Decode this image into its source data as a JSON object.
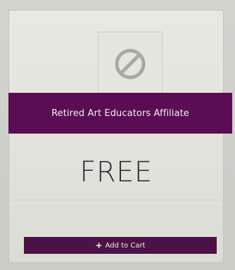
{
  "product": {
    "title": "Retired Art Educators Affiliate",
    "price": "FREE",
    "image_icon": "no-image-icon"
  },
  "actions": {
    "add_to_cart_icon": "+",
    "add_to_cart_label": "Add to Cart"
  },
  "colors": {
    "accent": "#5a0d52",
    "button": "#4b1246",
    "placeholder_icon": "#a8a8a4"
  }
}
